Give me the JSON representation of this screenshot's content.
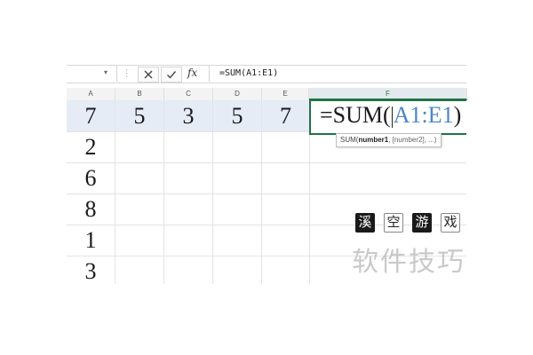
{
  "formula_bar": {
    "name_box": "",
    "fx_label": "fx",
    "formula": "=SUM(A1:E1)"
  },
  "columns": [
    "A",
    "B",
    "C",
    "D",
    "E",
    "F"
  ],
  "row1": [
    "7",
    "5",
    "3",
    "5",
    "7"
  ],
  "column_a_values": [
    "2",
    "6",
    "8",
    "1",
    "3"
  ],
  "active_cell": {
    "prefix": "=SUM(",
    "reference": "A1:E1",
    "suffix": ")"
  },
  "tooltip": {
    "function": "SUM(",
    "arg1": "number1",
    "rest": ", [number2], ...)"
  },
  "watermark": {
    "chips": [
      "溪",
      "空",
      "游",
      "戏"
    ],
    "text": "软件技巧"
  },
  "colors": {
    "accent": "#217346",
    "ref_blue": "#4a86c8",
    "row_highlight": "#e6ecf6"
  }
}
